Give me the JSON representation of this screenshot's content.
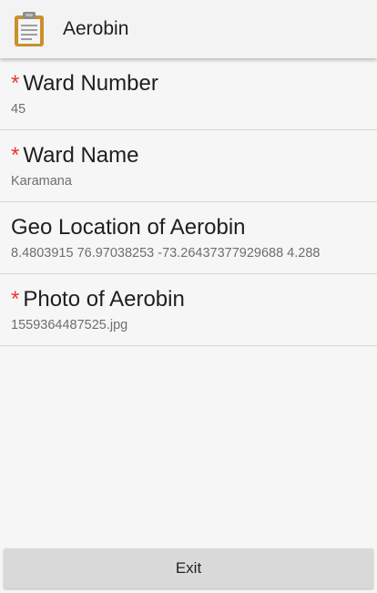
{
  "app_bar": {
    "title": "Aerobin",
    "icon": "clipboard-icon"
  },
  "fields": [
    {
      "label": "Ward Number",
      "required": true,
      "value": "45"
    },
    {
      "label": "Ward Name",
      "required": true,
      "value": "Karamana"
    },
    {
      "label": "Geo Location of Aerobin",
      "required": false,
      "value": "8.4803915 76.97038253 -73.26437377929688 4.288"
    },
    {
      "label": "Photo of Aerobin",
      "required": true,
      "value": "1559364487525.jpg"
    }
  ],
  "required_marker": "*",
  "footer": {
    "exit_label": "Exit"
  },
  "colors": {
    "required": "#e53935",
    "clipboard_board": "#c8912d",
    "clipboard_clip": "#8d8d8d"
  }
}
